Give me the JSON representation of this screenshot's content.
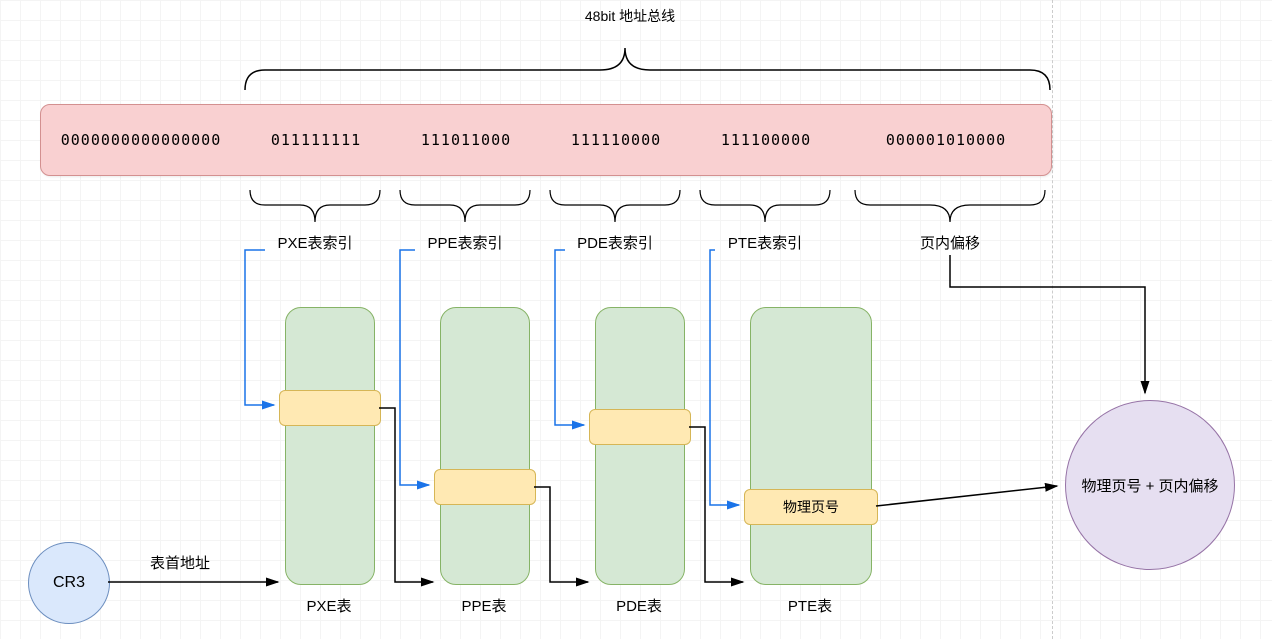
{
  "title": "48bit 地址总线",
  "address_segments": {
    "seg0": "0000000000000000",
    "seg1": "011111111",
    "seg2": "111011000",
    "seg3": "111110000",
    "seg4": "111100000",
    "seg5": "000001010000"
  },
  "field_labels": {
    "pxe_index": "PXE表索引",
    "ppe_index": "PPE表索引",
    "pde_index": "PDE表索引",
    "pte_index": "PTE表索引",
    "offset": "页内偏移"
  },
  "tables": {
    "pxe": "PXE表",
    "ppe": "PPE表",
    "pde": "PDE表",
    "pte": "PTE表"
  },
  "pte_entry_label": "物理页号",
  "cr3": "CR3",
  "cr3_arrow_label": "表首地址",
  "result": "物理页号 + 页内偏移",
  "chart_data": {
    "type": "diagram",
    "description": "x86_64 4-level page table walk",
    "address_bits": 48,
    "register": "CR3",
    "levels": [
      {
        "name": "PXE",
        "index_label": "PXE表索引",
        "bits": "011111111"
      },
      {
        "name": "PPE",
        "index_label": "PPE表索引",
        "bits": "111011000"
      },
      {
        "name": "PDE",
        "index_label": "PDE表索引",
        "bits": "111110000"
      },
      {
        "name": "PTE",
        "index_label": "PTE表索引",
        "bits": "111100000"
      }
    ],
    "page_offset": {
      "label": "页内偏移",
      "bits": "000001010000"
    },
    "unused_high_bits": "0000000000000000",
    "result": "物理页号 + 页内偏移"
  }
}
